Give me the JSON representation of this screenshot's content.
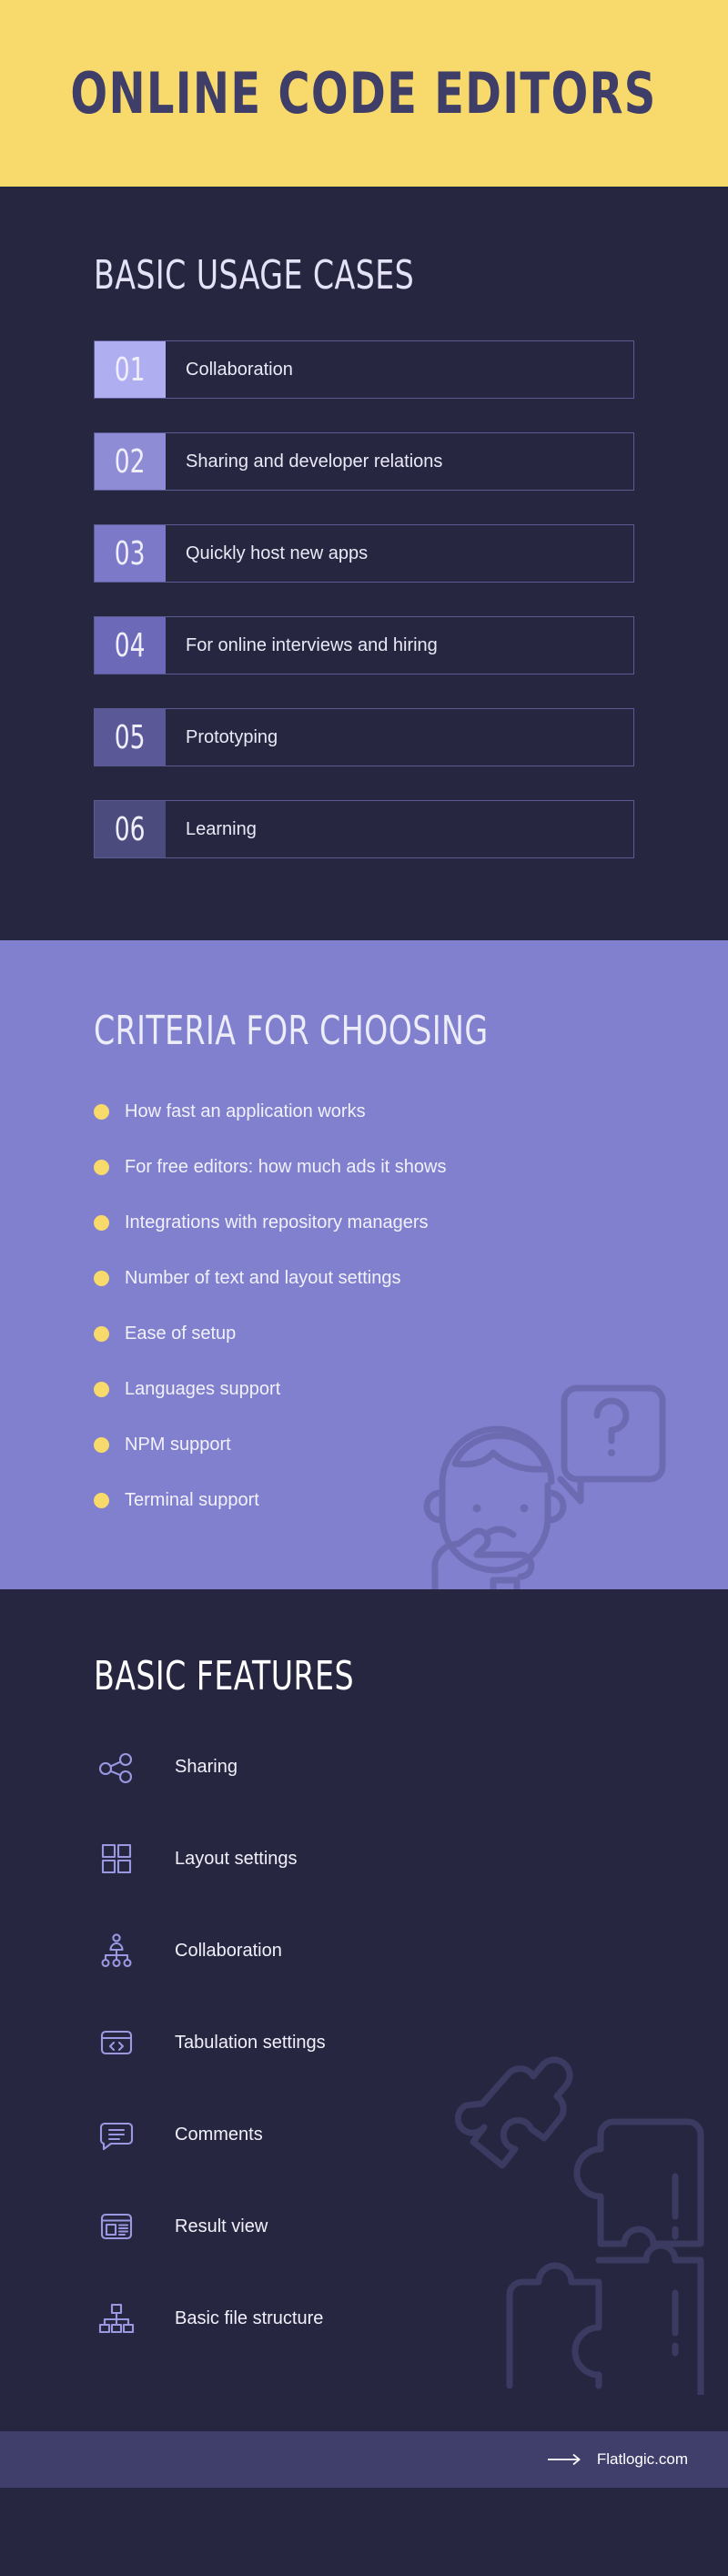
{
  "header": {
    "title": "ONLINE CODE EDITORS"
  },
  "usage": {
    "heading": "BASIC USAGE CASES",
    "items": [
      {
        "num": "01",
        "label": "Collaboration",
        "badge": "#AFAEF0"
      },
      {
        "num": "02",
        "label": "Sharing and developer relations",
        "badge": "#8E8CD5"
      },
      {
        "num": "03",
        "label": "Quickly host new apps",
        "badge": "#7B79C8"
      },
      {
        "num": "04",
        "label": "For online interviews and hiring",
        "badge": "#6B69B8"
      },
      {
        "num": "05",
        "label": "Prototyping",
        "badge": "#5A5896"
      },
      {
        "num": "06",
        "label": "Learning",
        "badge": "#4C4B7E"
      }
    ]
  },
  "criteria": {
    "heading": "CRITERIA FOR CHOOSING",
    "bullet_color": "#F8D96B",
    "items": [
      "How fast an application works",
      "For free editors: how much ads it shows",
      "Integrations with repository managers",
      "Number of text and layout settings",
      "Ease of setup",
      "Languages support",
      "NPM support",
      "Terminal support"
    ],
    "illustration": "thinking-person-question-icon"
  },
  "features": {
    "heading": "BASIC FEATURES",
    "items": [
      {
        "label": "Sharing",
        "icon": "share-nodes-icon"
      },
      {
        "label": "Layout settings",
        "icon": "grid-squares-icon"
      },
      {
        "label": "Collaboration",
        "icon": "org-chart-person-icon"
      },
      {
        "label": "Tabulation settings",
        "icon": "code-window-icon"
      },
      {
        "label": "Comments",
        "icon": "comment-bubble-icon"
      },
      {
        "label": "Result view",
        "icon": "result-window-icon"
      },
      {
        "label": "Basic file structure",
        "icon": "file-tree-icon"
      }
    ],
    "illustration": "puzzle-pieces-icon"
  },
  "footer": {
    "arrow": "→",
    "text": "Flatlogic.com"
  },
  "colors": {
    "yellow": "#F8D96B",
    "navy": "#262640",
    "purple": "#8180CE",
    "footer": "#403F6B",
    "icon_stroke": "#9A98E0"
  }
}
